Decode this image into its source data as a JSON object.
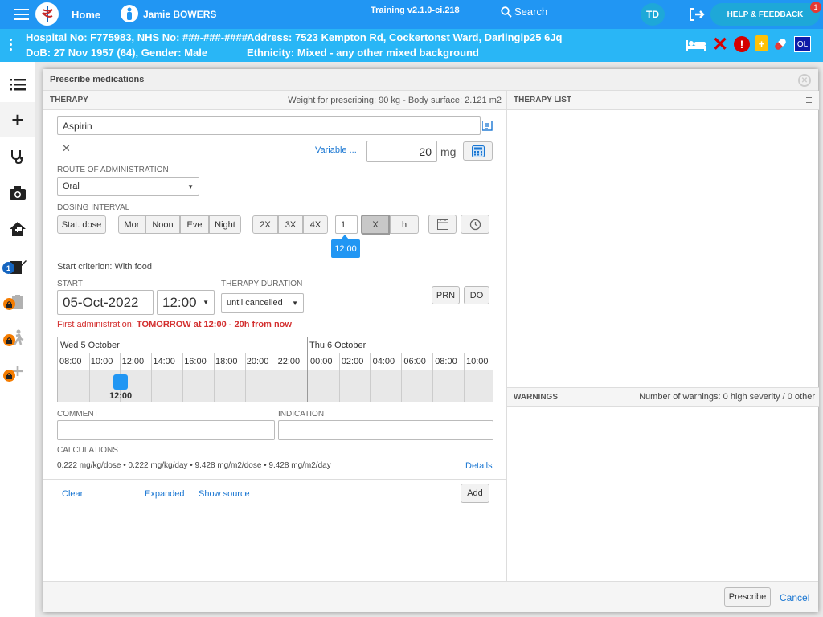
{
  "topbar": {
    "home_label": "Home",
    "patient_name": "Jamie BOWERS",
    "build": "Training v2.1.0-ci.218",
    "search_label": "Search",
    "user_initials": "TD",
    "help_label": "HELP & FEEDBACK",
    "help_badge": "1"
  },
  "patient": {
    "line1": "Hospital No: F775983, NHS No: ###-###-####",
    "line2": "DoB: 27 Nov 1957 (64), Gender: Male",
    "address": "Address: 7523 Kempton Rd, Cockertonst Ward, Darlingip25 6Jq",
    "ethnicity": "Ethnicity: Mixed - any other mixed background",
    "ol_badge": "OL"
  },
  "sidebar": {
    "badge_count": "1"
  },
  "modal": {
    "title": "Prescribe medications",
    "therapy_header": "THERAPY",
    "weight_text": "Weight for prescribing: 90 kg - Body surface: 2.121 m2",
    "therapy_list_header": "THERAPY LIST",
    "medication": "Aspirin",
    "variable_label": "Variable ...",
    "dose_value": "20",
    "dose_unit": "mg",
    "route_label": "ROUTE OF ADMINISTRATION",
    "route_value": "Oral",
    "dosing_interval_label": "DOSING INTERVAL",
    "stat_dose": "Stat. dose",
    "times": [
      "Mor",
      "Noon",
      "Eve",
      "Night"
    ],
    "freqs": [
      "2X",
      "3X",
      "4X"
    ],
    "interval_value": "1",
    "x_label": "X",
    "h_label": "h",
    "time_tag": "12:00",
    "start_criterion": "Start criterion: With food",
    "start_label": "START",
    "start_date": "05-Oct-2022",
    "start_time": "12:00",
    "duration_label": "THERAPY DURATION",
    "duration_value": "until cancelled",
    "prn": "PRN",
    "do": "DO",
    "first_admin_prefix": "First administration: ",
    "first_admin_value": "TOMORROW at 12:00 - 20h from now",
    "day1": "Wed 5 October",
    "day2": "Thu 6 October",
    "hours1": [
      "08:00",
      "10:00",
      "12:00",
      "14:00",
      "16:00",
      "18:00",
      "20:00",
      "22:00"
    ],
    "hours2": [
      "00:00",
      "02:00",
      "04:00",
      "06:00",
      "08:00",
      "10:00"
    ],
    "dose_marker_time": "12:00",
    "comment_label": "COMMENT",
    "indication_label": "INDICATION",
    "calc_label": "CALCULATIONS",
    "calc_text": "0.222 mg/kg/dose • 0.222 mg/kg/day • 9.428 mg/m2/dose • 9.428 mg/m2/day",
    "details": "Details",
    "clear": "Clear",
    "expanded": "Expanded",
    "show_source": "Show source",
    "add": "Add",
    "warnings_header": "WARNINGS",
    "warnings_text": "Number of warnings: 0 high severity / 0 other",
    "prescribe": "Prescribe",
    "cancel": "Cancel"
  }
}
